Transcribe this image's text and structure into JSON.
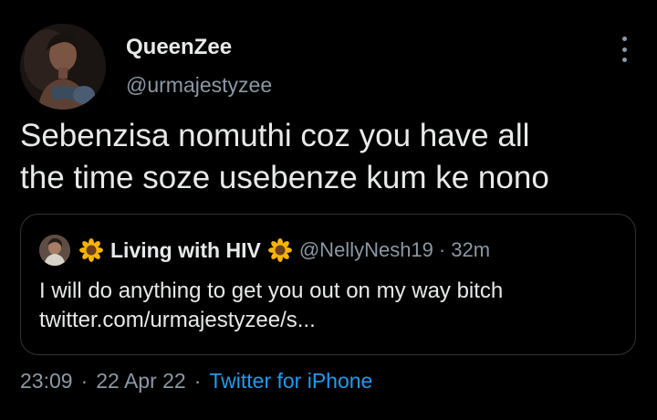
{
  "tweet": {
    "author": {
      "display_name": "QueenZee",
      "handle": "@urmajestyzee"
    },
    "text_lines": [
      "Sebenzisa nomuthi coz you have all",
      "the time soze usebenze kum ke nono"
    ],
    "more_icon": "more-vertical-icon",
    "quoted": {
      "display_name": "Living with HIV",
      "emoji_icon": "sunflower-icon",
      "handle": "@NellyNesh19",
      "separator": "·",
      "relative_time": "32m",
      "text_lines": [
        "I will do anything to get you out on my way bitch",
        "twitter.com/urmajestyzee/s..."
      ]
    },
    "meta": {
      "time": "23:09",
      "date": "22 Apr 22",
      "separator": "·",
      "source": "Twitter for iPhone"
    }
  },
  "colors": {
    "background": "#000000",
    "text_primary": "#e7e9ea",
    "text_secondary": "#8b98a5",
    "link": "#1d9bf0",
    "border": "#2f3336",
    "sunflower_petal": "#f7b500",
    "sunflower_center": "#6b3d1a"
  }
}
